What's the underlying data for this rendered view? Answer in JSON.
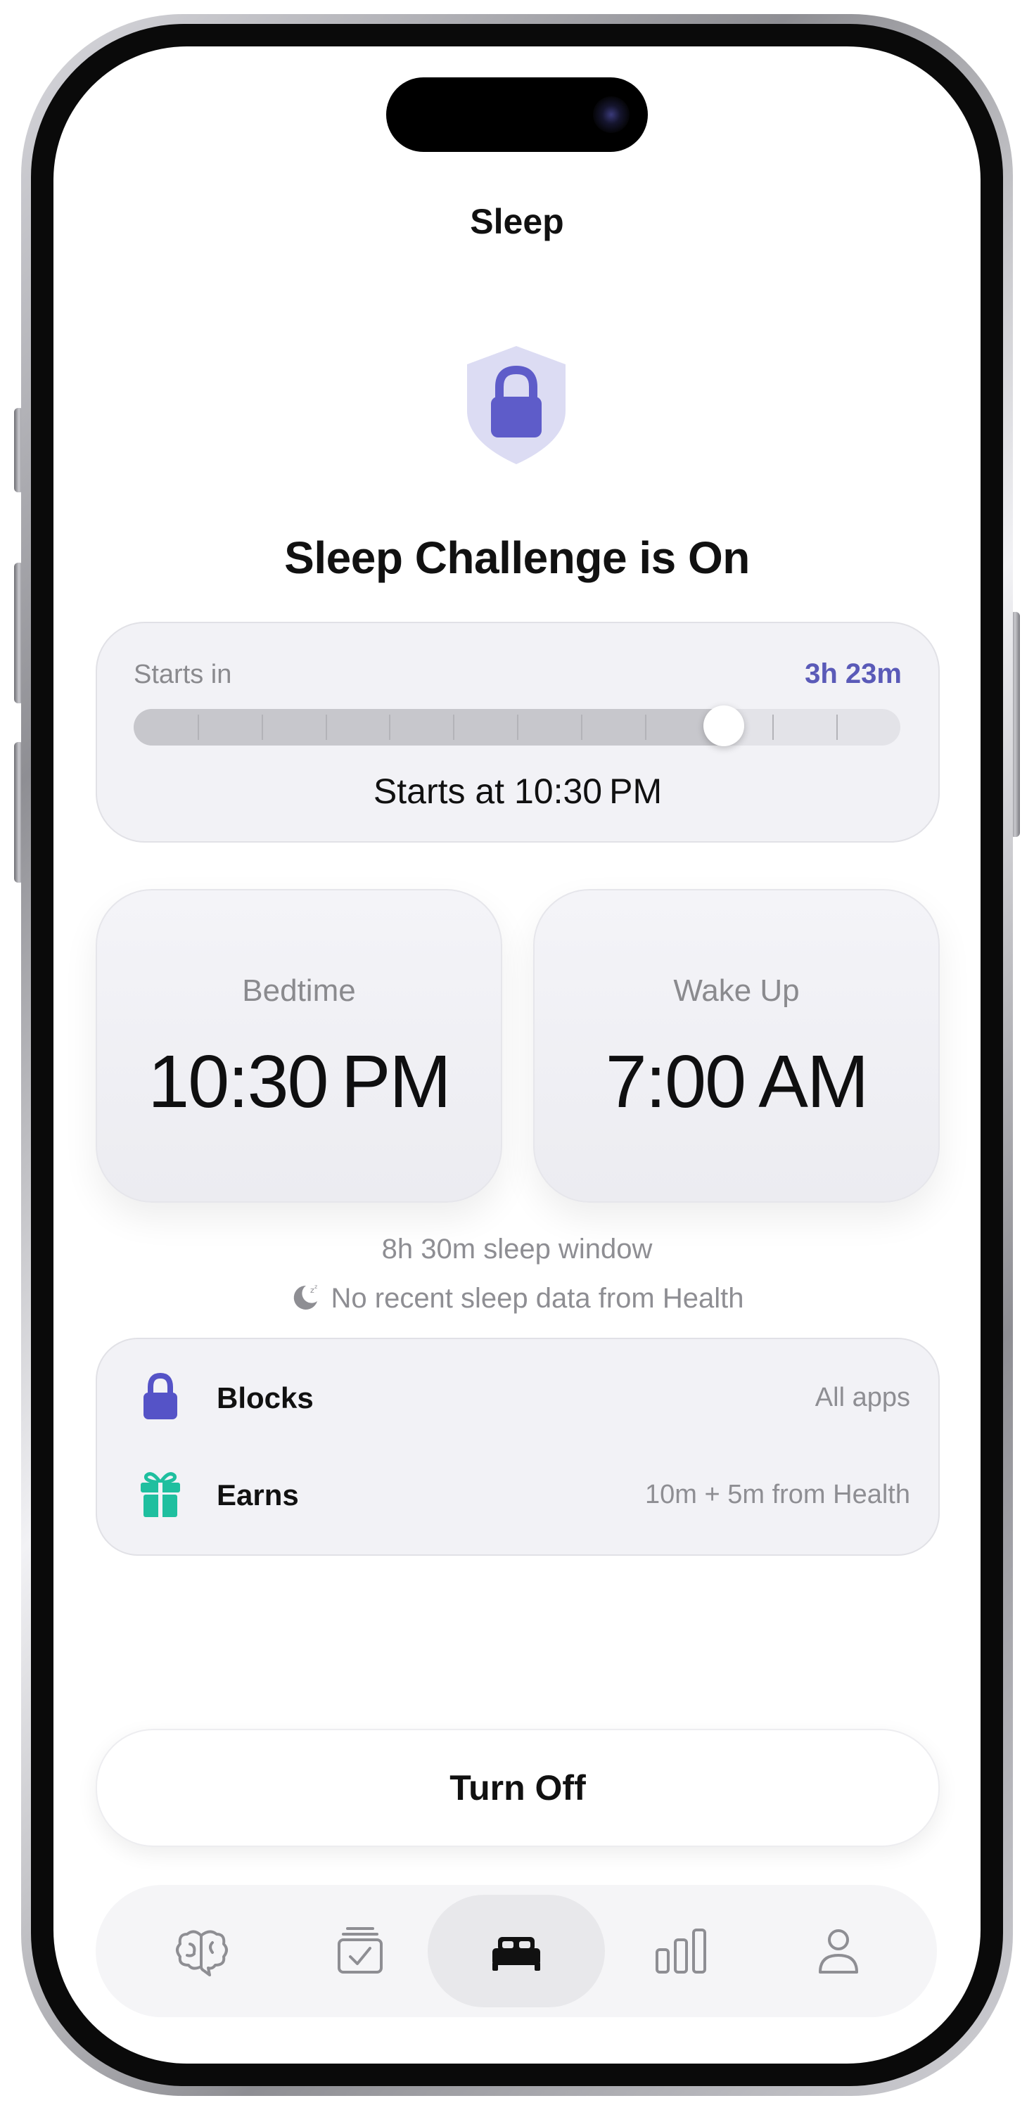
{
  "nav": {
    "title": "Sleep"
  },
  "hero": {
    "title": "Sleep Challenge is On",
    "icon": "lock-shield-icon"
  },
  "countdown": {
    "label": "Starts in",
    "remaining": "3h 23m",
    "progress": 0.77,
    "tick_count": 12,
    "starts_at": "Starts at 10:30 PM"
  },
  "schedule": {
    "bedtime": {
      "label": "Bedtime",
      "time": "10:30 PM"
    },
    "wakeup": {
      "label": "Wake Up",
      "time": "7:00 AM"
    },
    "window": "8h 30m sleep window",
    "health_status": "No recent sleep data from Health"
  },
  "rules": [
    {
      "label": "Blocks",
      "value": "All apps",
      "icon": "lock-icon",
      "color": "#5553c7"
    },
    {
      "label": "Earns",
      "value": "10m + 5m from Health",
      "icon": "gift-icon",
      "color": "#1fbf9f"
    }
  ],
  "actions": {
    "turn_off": "Turn Off"
  },
  "tabs": [
    {
      "name": "brain-icon",
      "active": false
    },
    {
      "name": "tasks-icon",
      "active": false
    },
    {
      "name": "bed-icon",
      "active": true
    },
    {
      "name": "stats-icon",
      "active": false
    },
    {
      "name": "profile-icon",
      "active": false
    }
  ],
  "colors": {
    "accent": "#5a5ab8",
    "lock": "#5553c7",
    "gift": "#1fbf9f",
    "card_bg": "#f2f2f6"
  }
}
